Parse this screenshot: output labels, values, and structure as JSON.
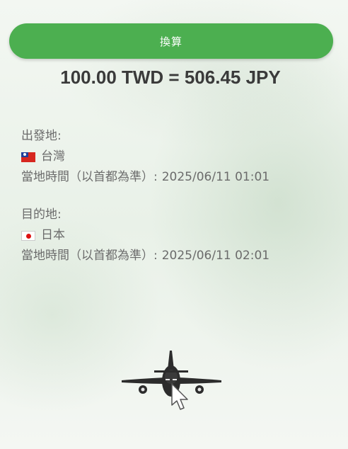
{
  "convert": {
    "label": "換算"
  },
  "result": {
    "text": "100.00 TWD = 506.45 JPY"
  },
  "departure": {
    "heading": "出發地:",
    "country": "台灣",
    "time_label": "當地時間（以首都為準）:",
    "time_value": "2025/06/11 01:01"
  },
  "destination": {
    "heading": "目的地:",
    "country": "日本",
    "time_label": "當地時間（以首都為準）:",
    "time_value": "2025/06/11 02:01"
  },
  "icons": {
    "departure_flag": "taiwan-flag-icon",
    "destination_flag": "japan-flag-icon",
    "plane": "airplane-icon",
    "cursor": "mouse-cursor-icon"
  },
  "colors": {
    "accent": "#4caf50",
    "text": "#6b6b6b",
    "result": "#3a3a3a"
  }
}
